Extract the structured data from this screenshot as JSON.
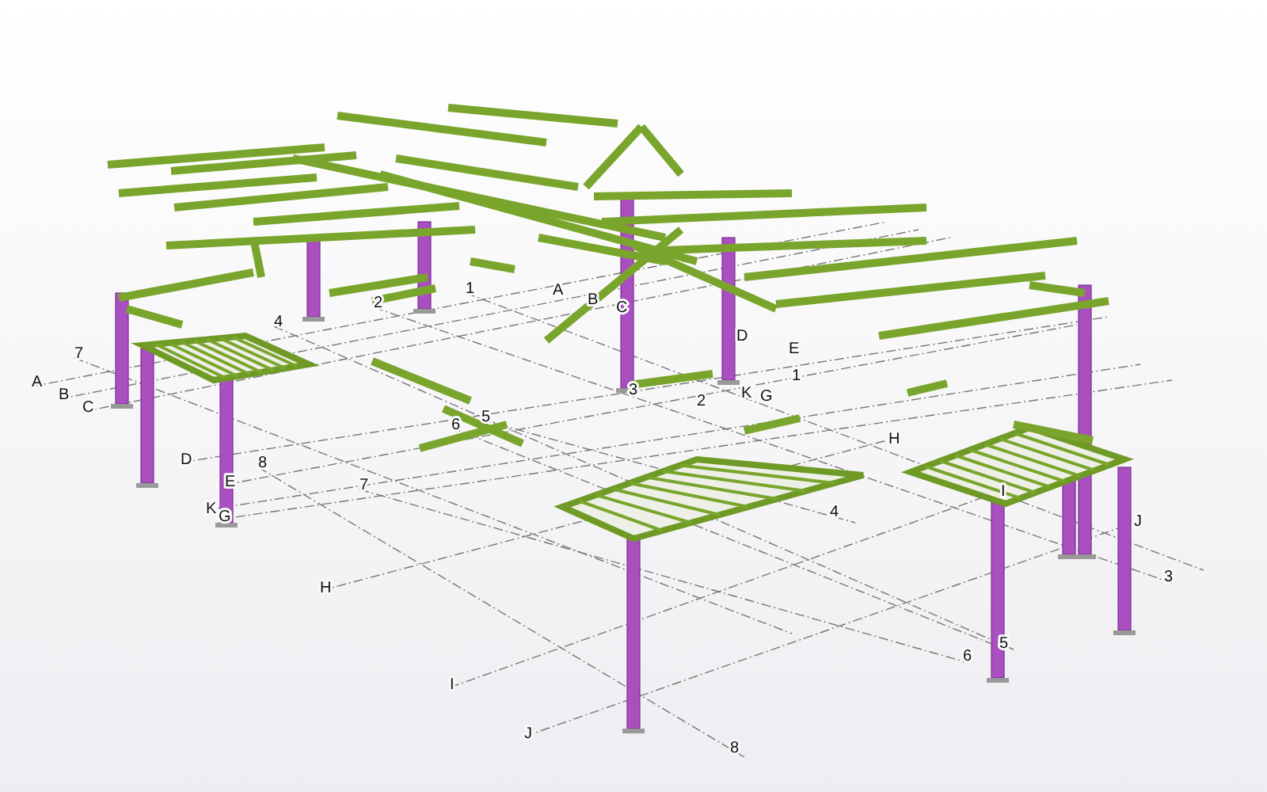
{
  "viewport": {
    "grid_labels": [
      {
        "text": "7"
      },
      {
        "text": "A"
      },
      {
        "text": "B"
      },
      {
        "text": "C"
      },
      {
        "text": "4"
      },
      {
        "text": "2"
      },
      {
        "text": "1"
      },
      {
        "text": "A"
      },
      {
        "text": "B"
      },
      {
        "text": "C"
      },
      {
        "text": "D"
      },
      {
        "text": "E"
      },
      {
        "text": "1"
      },
      {
        "text": "3"
      },
      {
        "text": "2"
      },
      {
        "text": "K"
      },
      {
        "text": "G"
      },
      {
        "text": "6"
      },
      {
        "text": "5"
      },
      {
        "text": "D"
      },
      {
        "text": "8"
      },
      {
        "text": "E"
      },
      {
        "text": "7"
      },
      {
        "text": "K"
      },
      {
        "text": "G"
      },
      {
        "text": "H"
      },
      {
        "text": "4"
      },
      {
        "text": "I"
      },
      {
        "text": "J"
      },
      {
        "text": "3"
      },
      {
        "text": "H"
      },
      {
        "text": "5"
      },
      {
        "text": "6"
      },
      {
        "text": "I"
      },
      {
        "text": "J"
      },
      {
        "text": "8"
      }
    ]
  }
}
